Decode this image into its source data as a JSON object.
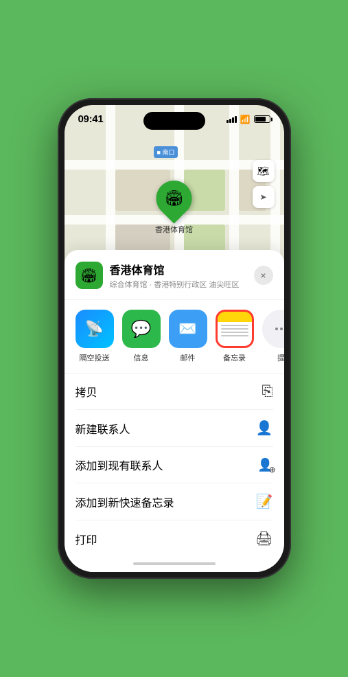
{
  "status_bar": {
    "time": "09:41",
    "location_icon": "▲"
  },
  "map": {
    "label_nankou": "南口",
    "label_prefix": "■",
    "venue_pin_label": "香港体育馆",
    "venue_pin_emoji": "🏟"
  },
  "map_controls": {
    "map_type_icon": "🗺",
    "location_icon": "⬆"
  },
  "bottom_sheet": {
    "venue_icon_emoji": "🏟",
    "venue_name": "香港体育馆",
    "venue_subtitle": "综合体育馆 · 香港特别行政区 油尖旺区",
    "close_label": "×",
    "share_apps": [
      {
        "id": "airdrop",
        "label": "隔空投送",
        "type": "airdrop"
      },
      {
        "id": "messages",
        "label": "信息",
        "type": "messages"
      },
      {
        "id": "mail",
        "label": "邮件",
        "type": "mail"
      },
      {
        "id": "notes",
        "label": "备忘录",
        "type": "notes"
      },
      {
        "id": "more",
        "label": "提",
        "type": "more"
      }
    ],
    "actions": [
      {
        "id": "copy",
        "label": "拷贝",
        "icon": "📋"
      },
      {
        "id": "new-contact",
        "label": "新建联系人",
        "icon": "👤"
      },
      {
        "id": "add-existing",
        "label": "添加到现有联系人",
        "icon": "👤"
      },
      {
        "id": "add-notes",
        "label": "添加到新快速备忘录",
        "icon": "📝"
      },
      {
        "id": "print",
        "label": "打印",
        "icon": "🖨"
      }
    ]
  }
}
